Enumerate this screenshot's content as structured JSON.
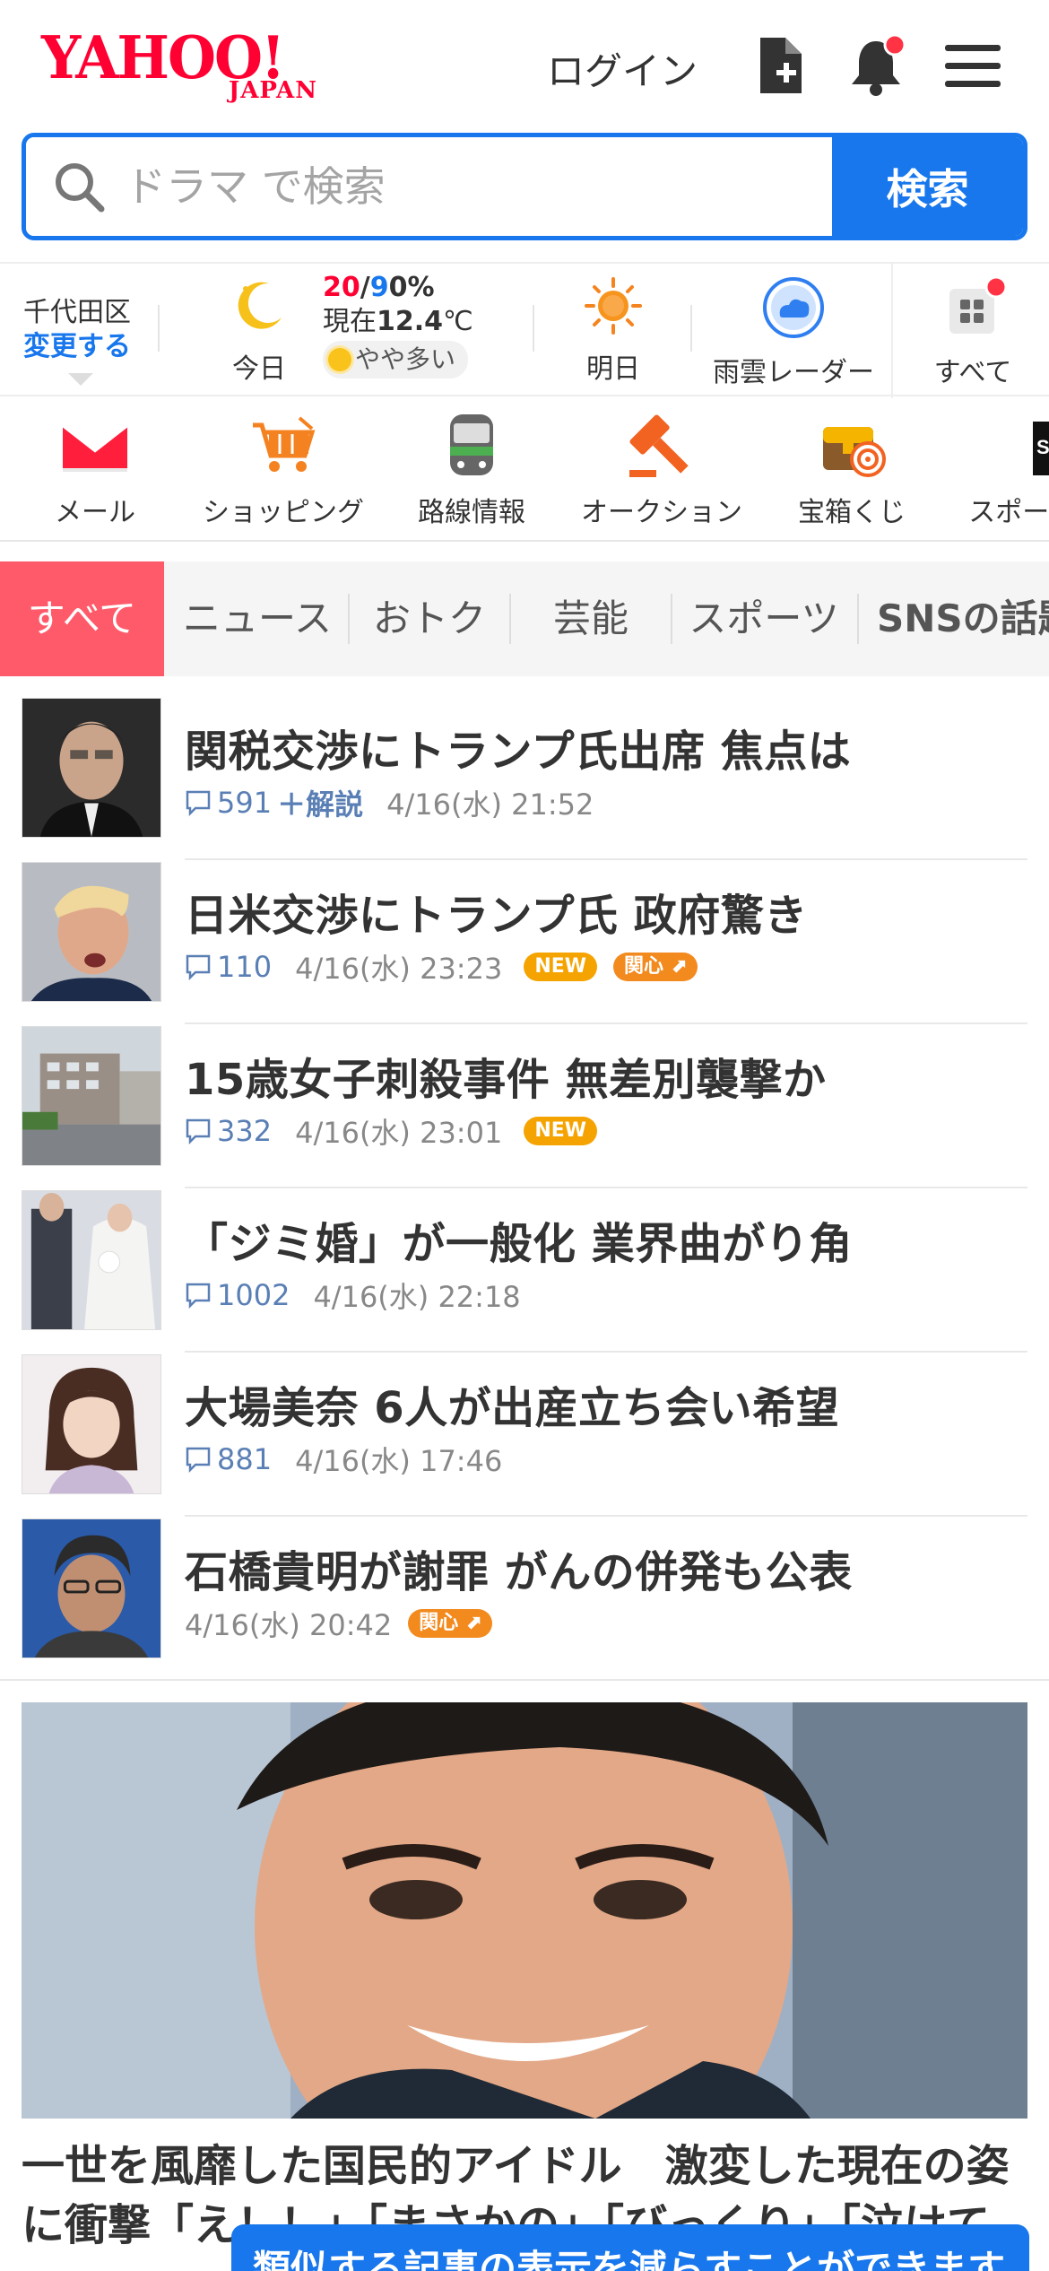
{
  "header": {
    "logo_main": "YAHOO!",
    "logo_sub": "JAPAN",
    "login_label": "ログイン"
  },
  "search": {
    "placeholder": "ドラマ で検索",
    "button_label": "検索"
  },
  "weather": {
    "area": "千代田区",
    "change_label": "変更する",
    "today_label": "今日",
    "high": "20",
    "low": "9",
    "rain": "0%",
    "current_prefix": "現在",
    "current_temp": "12.4",
    "current_unit": "℃",
    "pollen": "やや多い",
    "tomorrow_label": "明日",
    "radar_label": "雨雲レーダー",
    "all_label": "すべて"
  },
  "services": [
    {
      "label": "メール",
      "icon": "mail-icon"
    },
    {
      "label": "ショッピング",
      "icon": "cart-icon"
    },
    {
      "label": "路線情報",
      "icon": "train-icon"
    },
    {
      "label": "オークション",
      "icon": "hammer-icon"
    },
    {
      "label": "宝箱くじ",
      "icon": "treasure-icon"
    },
    {
      "label": "スポーツ",
      "icon": "sports-icon"
    }
  ],
  "tabs": [
    "すべて",
    "ニュース",
    "おトク",
    "芸能",
    "スポーツ",
    "SNSの話題"
  ],
  "news": [
    {
      "title": "関税交渉にトランプ氏出席 焦点は",
      "comments": "591",
      "extra": "＋解説",
      "date": "4/16(水) 21:52",
      "badges": []
    },
    {
      "title": "日米交渉にトランプ氏 政府驚き",
      "comments": "110",
      "extra": "",
      "date": "4/16(水) 23:23",
      "badges": [
        "NEW",
        "関心"
      ]
    },
    {
      "title": "15歳女子刺殺事件 無差別襲撃か",
      "comments": "332",
      "extra": "",
      "date": "4/16(水) 23:01",
      "badges": [
        "NEW"
      ]
    },
    {
      "title": "「ジミ婚」が一般化 業界曲がり角",
      "comments": "1002",
      "extra": "",
      "date": "4/16(水) 22:18",
      "badges": []
    },
    {
      "title": "大場美奈 6人が出産立ち会い希望",
      "comments": "881",
      "extra": "",
      "date": "4/16(水) 17:46",
      "badges": []
    },
    {
      "title": "石橋貴明が謝罪 がんの併発も公表",
      "comments": "",
      "extra": "",
      "date": "4/16(水) 20:42",
      "badges": [
        "関心"
      ]
    }
  ],
  "feature": {
    "title": "一世を風靡した国民的アイドル　激変した現在の姿に衝撃「え！！」「まさかの」「びっくり」「泣けて"
  },
  "toast": "類似する記事の表示を減らすことができます",
  "colors": {
    "brand": "#ff0033",
    "accent": "#1877ec",
    "tab_active": "#ff5a6a"
  }
}
